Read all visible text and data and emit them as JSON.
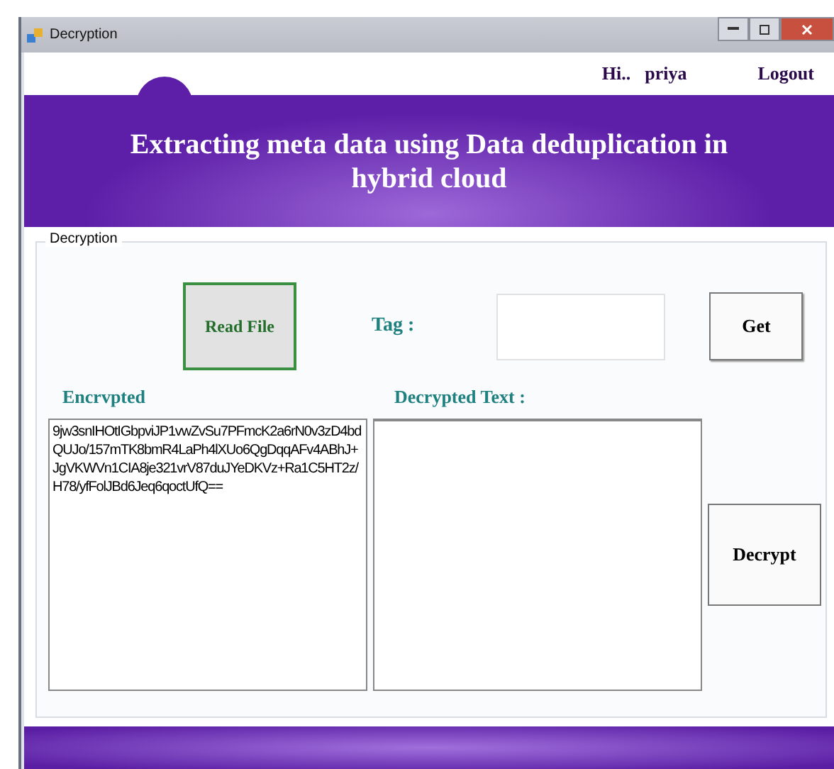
{
  "window": {
    "title": "Decryption"
  },
  "header": {
    "greeting": "Hi..",
    "user": "priya",
    "logout": "Logout"
  },
  "banner": {
    "title": "Extracting meta data using Data deduplication in hybrid cloud"
  },
  "group": {
    "title": "Decryption",
    "read_button": "Read File",
    "tag_label": "Tag :",
    "get_button": "Get",
    "encrypted_label": "Encrvpted",
    "encrypted_text": "9jw3snIHOtIGbpviJP1vwZvSu7PFmcK2a6rN0v3zD4bdQUJo/157mTK8bmR4LaPh4lXUo6QgDqqAFv4ABhJ+JgVKWVn1CIA8je321vrV87duJYeDKVz+Ra1C5HT2z/H78/yfFolJBd6Jeq6qoctUfQ==",
    "decrypted_label": "Decrypted Text :",
    "decrypt_button": "Decrypt"
  }
}
